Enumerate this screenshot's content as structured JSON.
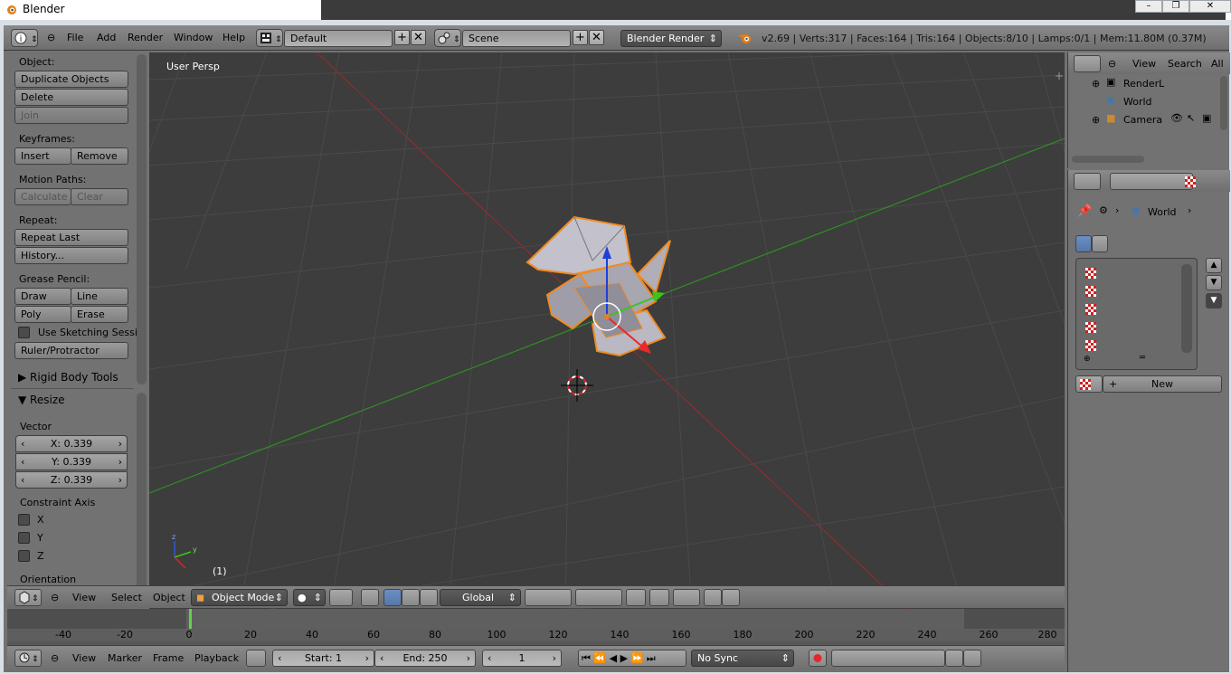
{
  "window": {
    "title": "Blender",
    "controls": [
      "–",
      "❐",
      "✕"
    ]
  },
  "topbar": {
    "menu": [
      "File",
      "Add",
      "Render",
      "Window",
      "Help"
    ],
    "layout": "Default",
    "scene": "Scene",
    "render_engine": "Blender Render",
    "stats": "v2.69 | Verts:317 | Faces:164 | Tris:164 | Objects:8/10 | Lamps:0/1 | Mem:11.80M (0.37M)"
  },
  "toolshelf": {
    "object_label": "Object:",
    "duplicate": "Duplicate Objects",
    "delete": "Delete",
    "join": "Join",
    "keyframes_label": "Keyframes:",
    "insert": "Insert",
    "remove": "Remove",
    "motion_paths_label": "Motion Paths:",
    "calculate": "Calculate",
    "clear": "Clear",
    "repeat_label": "Repeat:",
    "repeat_last": "Repeat Last",
    "history": "History...",
    "grease_label": "Grease Pencil:",
    "draw": "Draw",
    "line": "Line",
    "poly": "Poly",
    "erase": "Erase",
    "sketching": "Use Sketching Sessi",
    "ruler": "Ruler/Protractor",
    "rigid_body": "Rigid Body Tools",
    "resize": "Resize",
    "vector_label": "Vector",
    "x": "X: 0.339",
    "y": "Y: 0.339",
    "z": "Z: 0.339",
    "constraint_label": "Constraint Axis",
    "cx": "X",
    "cy": "Y",
    "cz": "Z",
    "orientation_label": "Orientation"
  },
  "viewport": {
    "label": "User Persp",
    "frame": "(1)"
  },
  "vheader": {
    "view": "View",
    "select": "Select",
    "object": "Object",
    "mode": "Object Mode",
    "orientation": "Global"
  },
  "timeline": {
    "ticks": [
      "-40",
      "-20",
      "0",
      "20",
      "40",
      "60",
      "80",
      "100",
      "120",
      "140",
      "160",
      "180",
      "200",
      "220",
      "240",
      "260",
      "280"
    ]
  },
  "footer": {
    "view": "View",
    "marker": "Marker",
    "frame": "Frame",
    "playback": "Playback",
    "start": "Start: 1",
    "end": "End: 250",
    "current": "1",
    "sync": "No Sync"
  },
  "outliner": {
    "view": "View",
    "search": "Search",
    "all": "All",
    "rows": [
      "RenderL",
      "World",
      "Camera"
    ]
  },
  "properties": {
    "world": "World",
    "new": "New"
  },
  "colors": {
    "viewport_bg": "#3d3d3d",
    "x_axis": "#c83232",
    "y_axis": "#5ec01d",
    "selection": "#f08b23"
  }
}
